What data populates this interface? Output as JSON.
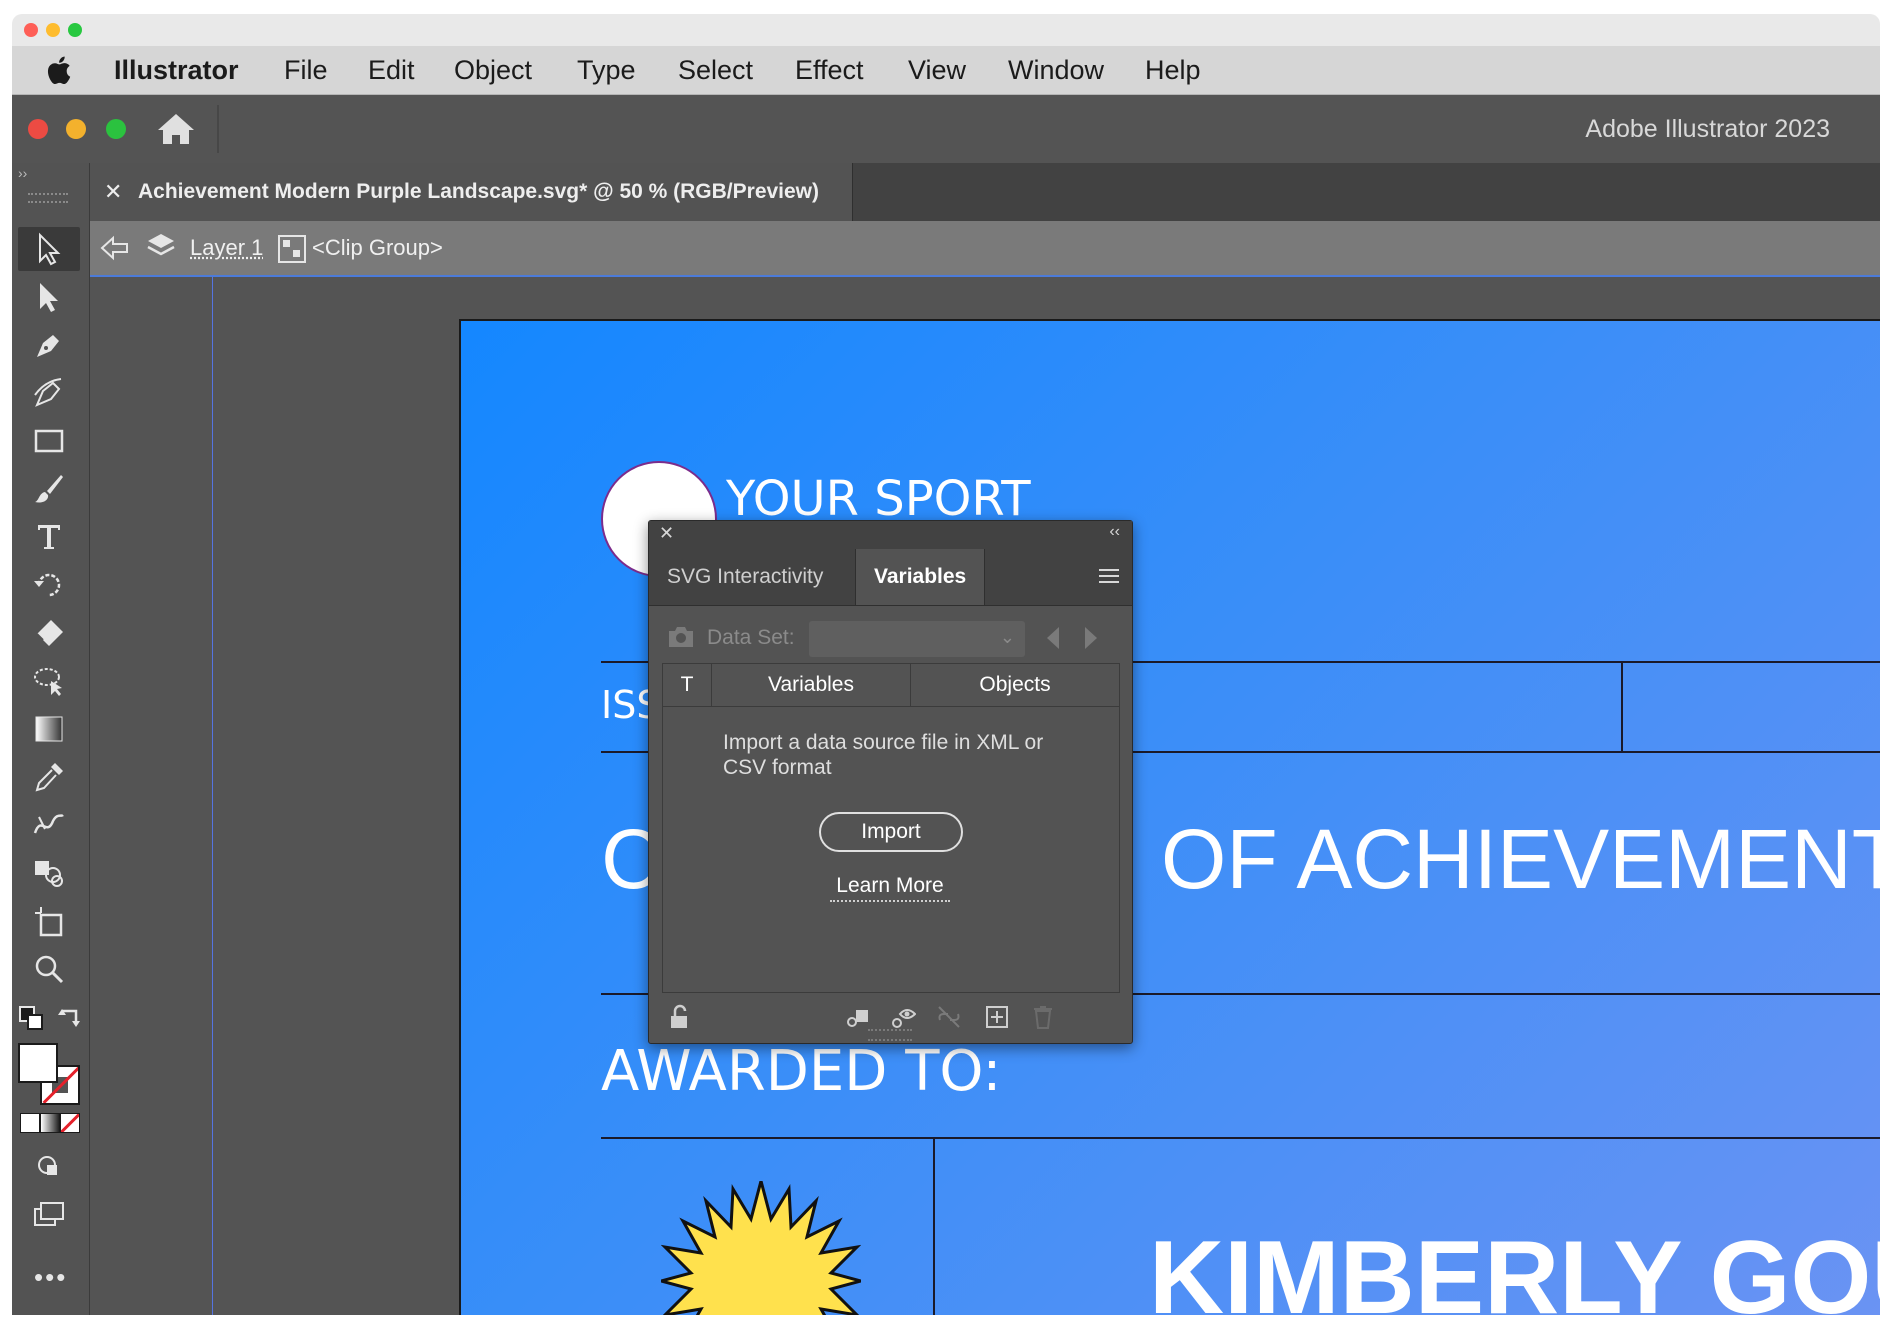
{
  "menubar": {
    "app_name": "Illustrator",
    "items": [
      "File",
      "Edit",
      "Object",
      "Type",
      "Select",
      "Effect",
      "View",
      "Window",
      "Help"
    ]
  },
  "appbar": {
    "title": "Adobe Illustrator 2023"
  },
  "document": {
    "tab_title": "Achievement Modern Purple Landscape.svg* @ 50 % (RGB/Preview)"
  },
  "breadcrumb": {
    "layer": "Layer 1",
    "group": "<Clip Group>"
  },
  "artboard": {
    "sport": "YOUR SPORT",
    "issued_partial": "ISS",
    "heading_left": "C",
    "heading_right": "OF ACHIEVEMENT",
    "awarded_to": "AWARDED TO:",
    "recipient": "KIMBERLY GOU"
  },
  "panel": {
    "tabs": [
      "SVG Interactivity",
      "Variables"
    ],
    "active_tab": "Variables",
    "data_set_label": "Data Set:",
    "columns": [
      "T",
      "Variables",
      "Objects"
    ],
    "import_message": "Import a data source file in XML or CSV format",
    "import_button": "Import",
    "learn_more": "Learn More"
  },
  "icons": {
    "toolbar": [
      "selection-tool-icon",
      "direct-selection-tool-icon",
      "pen-tool-icon",
      "curvature-tool-icon",
      "rectangle-tool-icon",
      "paintbrush-tool-icon",
      "type-tool-icon",
      "rotate-tool-icon",
      "eraser-tool-icon",
      "lasso-tool-icon",
      "gradient-tool-icon",
      "eyedropper-tool-icon",
      "width-tool-icon",
      "shape-builder-tool-icon",
      "artboard-tool-icon",
      "zoom-tool-icon"
    ]
  },
  "colors": {
    "accent": "#4c7bd9",
    "artboard_start": "#1487ff",
    "artboard_end": "#6a93f3",
    "sun": "#ffe14d"
  }
}
